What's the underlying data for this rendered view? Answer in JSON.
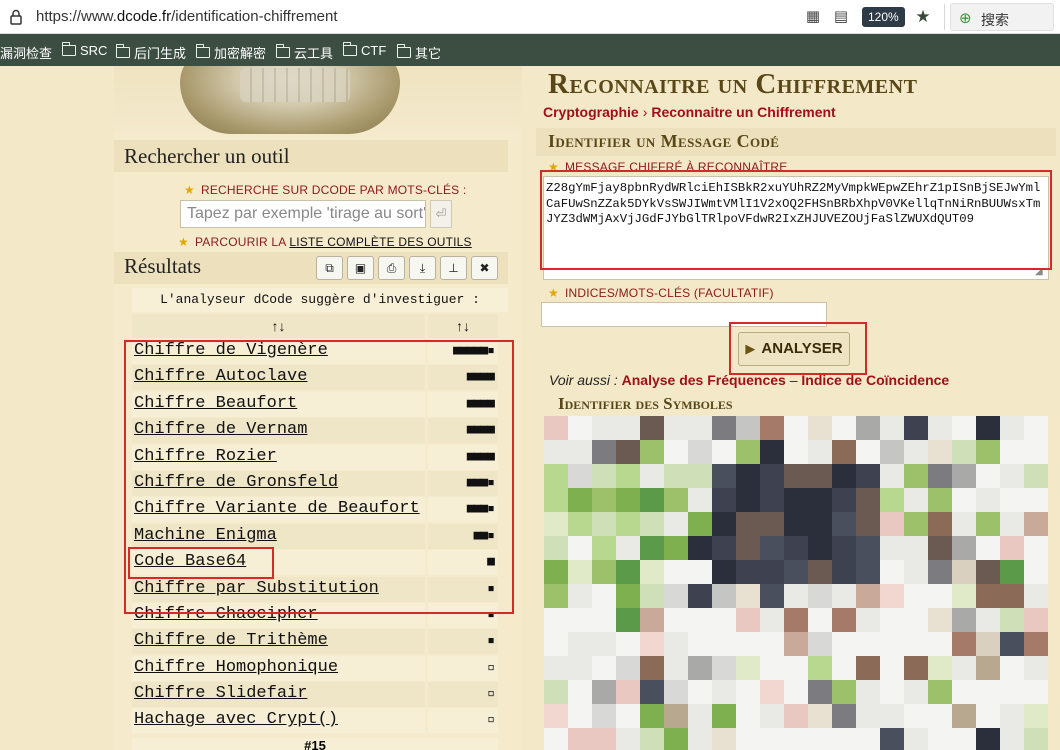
{
  "browser": {
    "url_prefix": "https://www.",
    "url_host": "dcode.fr",
    "url_path": "/identification-chiffrement",
    "zoom": "120%",
    "search_label": "搜索",
    "bookmarks": [
      "漏洞检查",
      "SRC",
      "后门生成",
      "加密解密",
      "云工具",
      "CTF",
      "其它"
    ]
  },
  "left": {
    "search_title": "Rechercher un outil",
    "keyword_label": "RECHERCHE SUR DCODE PAR MOTS-CLÉS :",
    "search_placeholder": "Tapez par exemple 'tirage au sort'",
    "browse_prefix": "PARCOURIR LA ",
    "browse_link": "LISTE COMPLÈTE DES OUTILS",
    "results_title": "Résultats",
    "suggest": "L'analyseur dCode suggère d'investiguer :",
    "col1": "↑↓",
    "col2": "↑↓",
    "results": [
      {
        "name": "Chiffre de Vigenère",
        "score": "■■■■■▪"
      },
      {
        "name": "Chiffre Autoclave",
        "score": "■■■■"
      },
      {
        "name": "Chiffre Beaufort",
        "score": "■■■■"
      },
      {
        "name": "Chiffre de Vernam",
        "score": "■■■■"
      },
      {
        "name": "Chiffre Rozier",
        "score": "■■■■"
      },
      {
        "name": "Chiffre de Gronsfeld",
        "score": "■■■▪"
      },
      {
        "name": "Chiffre Variante de Beaufort",
        "score": "■■■▪"
      },
      {
        "name": "Machine Enigma",
        "score": "■■▪"
      },
      {
        "name": "Code Base64",
        "score": "■"
      },
      {
        "name": "Chiffre par Substitution",
        "score": "▪"
      },
      {
        "name": "Chiffre Chaocipher",
        "score": "▪"
      },
      {
        "name": "Chiffre de Trithème",
        "score": "▪"
      },
      {
        "name": "Chiffre Homophonique",
        "score": "▫"
      },
      {
        "name": "Chiffre Slidefair",
        "score": "▫"
      },
      {
        "name": "Hachage avec Crypt()",
        "score": "▫"
      }
    ],
    "footer": "#15"
  },
  "right": {
    "title": "Reconnaitre un Chiffrement",
    "crumb1": "Cryptographie",
    "crumb2": "Reconnaitre un Chiffrement",
    "section_title": "Identifier un Message Codé",
    "message_label": "MESSAGE CHIFFRÉ À RECONNAÎTRE",
    "message": "Z28gYmFjay8pbnRydWRlciEhISBkR2xuYUhRZ2MyVmpkWEpwZEhrZ1pISnBjSEJwYmlCaFUwSnZZak5DYkVsSWJIWmtVMlI1V2xOQ2FHSnBRbXhpV0VKellqTnNiRnBUUWsxTmJYZ3dWMjAxVjJGdFJYbGlTRlpoVFdwR2IxZHJUVEZOUjFaSlZWUXdQUT09",
    "hint_label": "INDICES/MOTS-CLÉS (FACULTATIF)",
    "analyse_label": "ANALYSER",
    "voir_prefix": "Voir aussi : ",
    "voir_link1": "Analyse des Fréquences",
    "voir_sep": " – ",
    "voir_link2": "Indice de Coïncidence",
    "symbols_title": "Identifier des Symboles"
  },
  "colors": {
    "accent_red": "#a0101a",
    "title_brown": "#5a4718",
    "highlight": "#d42a2a",
    "bookmark_bar": "#3b4e41"
  }
}
